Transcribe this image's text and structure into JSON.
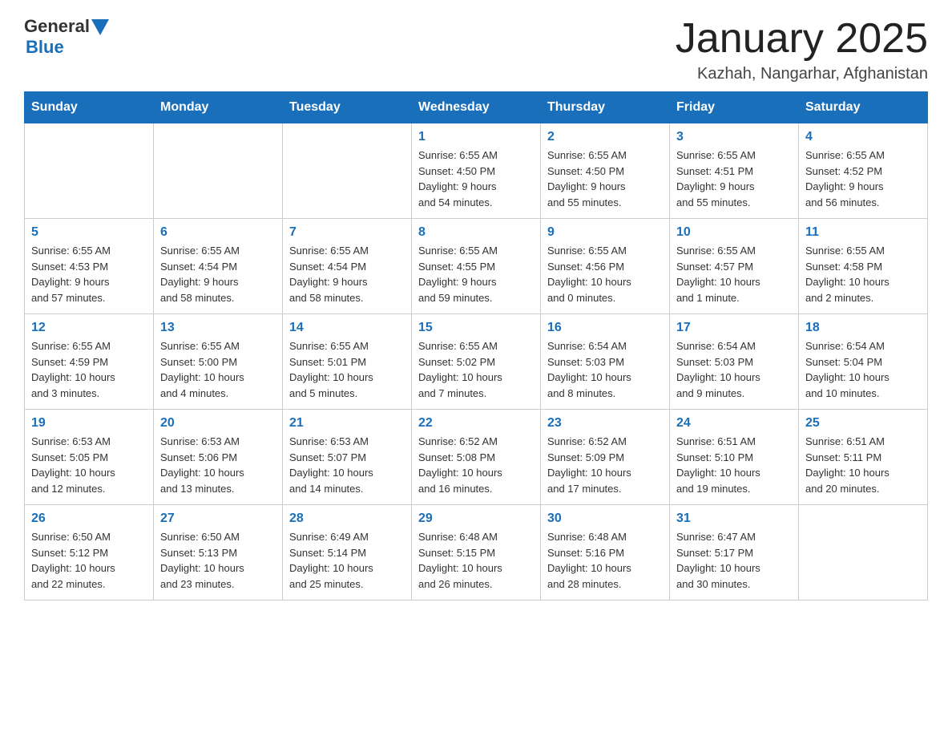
{
  "header": {
    "logo_general": "General",
    "logo_blue": "Blue",
    "title": "January 2025",
    "subtitle": "Kazhah, Nangarhar, Afghanistan"
  },
  "days_of_week": [
    "Sunday",
    "Monday",
    "Tuesday",
    "Wednesday",
    "Thursday",
    "Friday",
    "Saturday"
  ],
  "weeks": [
    [
      {
        "day": "",
        "info": ""
      },
      {
        "day": "",
        "info": ""
      },
      {
        "day": "",
        "info": ""
      },
      {
        "day": "1",
        "info": "Sunrise: 6:55 AM\nSunset: 4:50 PM\nDaylight: 9 hours\nand 54 minutes."
      },
      {
        "day": "2",
        "info": "Sunrise: 6:55 AM\nSunset: 4:50 PM\nDaylight: 9 hours\nand 55 minutes."
      },
      {
        "day": "3",
        "info": "Sunrise: 6:55 AM\nSunset: 4:51 PM\nDaylight: 9 hours\nand 55 minutes."
      },
      {
        "day": "4",
        "info": "Sunrise: 6:55 AM\nSunset: 4:52 PM\nDaylight: 9 hours\nand 56 minutes."
      }
    ],
    [
      {
        "day": "5",
        "info": "Sunrise: 6:55 AM\nSunset: 4:53 PM\nDaylight: 9 hours\nand 57 minutes."
      },
      {
        "day": "6",
        "info": "Sunrise: 6:55 AM\nSunset: 4:54 PM\nDaylight: 9 hours\nand 58 minutes."
      },
      {
        "day": "7",
        "info": "Sunrise: 6:55 AM\nSunset: 4:54 PM\nDaylight: 9 hours\nand 58 minutes."
      },
      {
        "day": "8",
        "info": "Sunrise: 6:55 AM\nSunset: 4:55 PM\nDaylight: 9 hours\nand 59 minutes."
      },
      {
        "day": "9",
        "info": "Sunrise: 6:55 AM\nSunset: 4:56 PM\nDaylight: 10 hours\nand 0 minutes."
      },
      {
        "day": "10",
        "info": "Sunrise: 6:55 AM\nSunset: 4:57 PM\nDaylight: 10 hours\nand 1 minute."
      },
      {
        "day": "11",
        "info": "Sunrise: 6:55 AM\nSunset: 4:58 PM\nDaylight: 10 hours\nand 2 minutes."
      }
    ],
    [
      {
        "day": "12",
        "info": "Sunrise: 6:55 AM\nSunset: 4:59 PM\nDaylight: 10 hours\nand 3 minutes."
      },
      {
        "day": "13",
        "info": "Sunrise: 6:55 AM\nSunset: 5:00 PM\nDaylight: 10 hours\nand 4 minutes."
      },
      {
        "day": "14",
        "info": "Sunrise: 6:55 AM\nSunset: 5:01 PM\nDaylight: 10 hours\nand 5 minutes."
      },
      {
        "day": "15",
        "info": "Sunrise: 6:55 AM\nSunset: 5:02 PM\nDaylight: 10 hours\nand 7 minutes."
      },
      {
        "day": "16",
        "info": "Sunrise: 6:54 AM\nSunset: 5:03 PM\nDaylight: 10 hours\nand 8 minutes."
      },
      {
        "day": "17",
        "info": "Sunrise: 6:54 AM\nSunset: 5:03 PM\nDaylight: 10 hours\nand 9 minutes."
      },
      {
        "day": "18",
        "info": "Sunrise: 6:54 AM\nSunset: 5:04 PM\nDaylight: 10 hours\nand 10 minutes."
      }
    ],
    [
      {
        "day": "19",
        "info": "Sunrise: 6:53 AM\nSunset: 5:05 PM\nDaylight: 10 hours\nand 12 minutes."
      },
      {
        "day": "20",
        "info": "Sunrise: 6:53 AM\nSunset: 5:06 PM\nDaylight: 10 hours\nand 13 minutes."
      },
      {
        "day": "21",
        "info": "Sunrise: 6:53 AM\nSunset: 5:07 PM\nDaylight: 10 hours\nand 14 minutes."
      },
      {
        "day": "22",
        "info": "Sunrise: 6:52 AM\nSunset: 5:08 PM\nDaylight: 10 hours\nand 16 minutes."
      },
      {
        "day": "23",
        "info": "Sunrise: 6:52 AM\nSunset: 5:09 PM\nDaylight: 10 hours\nand 17 minutes."
      },
      {
        "day": "24",
        "info": "Sunrise: 6:51 AM\nSunset: 5:10 PM\nDaylight: 10 hours\nand 19 minutes."
      },
      {
        "day": "25",
        "info": "Sunrise: 6:51 AM\nSunset: 5:11 PM\nDaylight: 10 hours\nand 20 minutes."
      }
    ],
    [
      {
        "day": "26",
        "info": "Sunrise: 6:50 AM\nSunset: 5:12 PM\nDaylight: 10 hours\nand 22 minutes."
      },
      {
        "day": "27",
        "info": "Sunrise: 6:50 AM\nSunset: 5:13 PM\nDaylight: 10 hours\nand 23 minutes."
      },
      {
        "day": "28",
        "info": "Sunrise: 6:49 AM\nSunset: 5:14 PM\nDaylight: 10 hours\nand 25 minutes."
      },
      {
        "day": "29",
        "info": "Sunrise: 6:48 AM\nSunset: 5:15 PM\nDaylight: 10 hours\nand 26 minutes."
      },
      {
        "day": "30",
        "info": "Sunrise: 6:48 AM\nSunset: 5:16 PM\nDaylight: 10 hours\nand 28 minutes."
      },
      {
        "day": "31",
        "info": "Sunrise: 6:47 AM\nSunset: 5:17 PM\nDaylight: 10 hours\nand 30 minutes."
      },
      {
        "day": "",
        "info": ""
      }
    ]
  ]
}
